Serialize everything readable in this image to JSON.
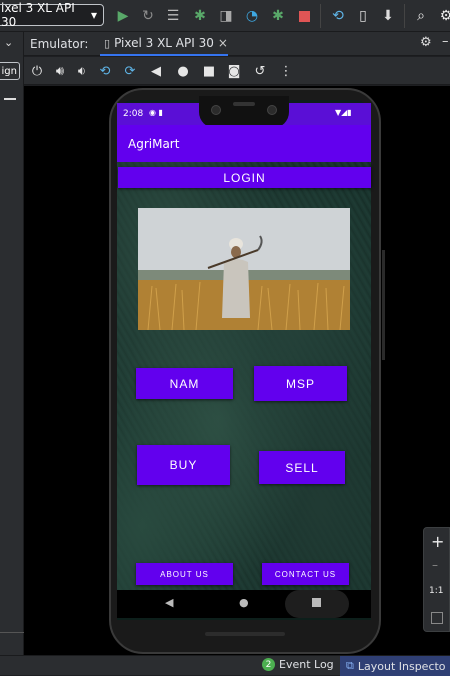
{
  "toolbar": {
    "device": "ixel 3 XL API 30",
    "icons": [
      "run-icon",
      "rerun-icon",
      "logcat-icon",
      "debug-icon",
      "attach-icon",
      "profile-icon",
      "apply-changes-icon",
      "stop-icon",
      "sync-icon",
      "device-manager-icon",
      "sdk-icon",
      "search-icon",
      "settings-icon"
    ],
    "run_color": "#59a869",
    "stop_color": "#e05555"
  },
  "left_gutter": {
    "sign_label": "ign"
  },
  "emulator_tabs": {
    "label": "Emulator:",
    "tab": "Pixel 3 XL API 30",
    "close": "×"
  },
  "phone": {
    "status_time": "2:08",
    "app_title": "AgriMart",
    "login_label": "LOGIN",
    "buttons": {
      "nam": "NAM",
      "msp": "MSP",
      "buy": "BUY",
      "sell": "SELL",
      "about": "ABOUT US",
      "contact": "CONTACT US"
    },
    "accent": "#6200ee"
  },
  "right_tools": {
    "zoom_in": "+",
    "zoom_out": "–",
    "ratio": "1:1"
  },
  "bottombar": {
    "event_log_count": "2",
    "event_log": "Event Log",
    "layout_inspector": "Layout Inspecto"
  }
}
